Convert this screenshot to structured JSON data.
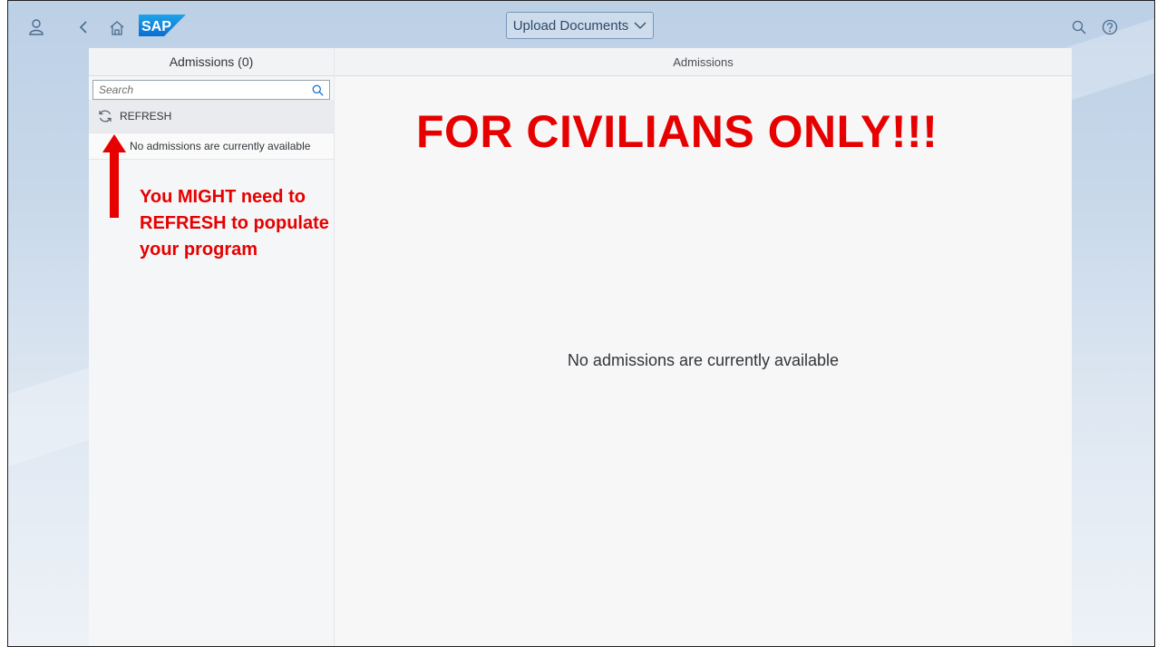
{
  "shell": {
    "app_title": "Upload Documents",
    "icons": [
      "user-icon",
      "back-icon",
      "home-icon",
      "sap-logo",
      "search-icon",
      "help-icon"
    ],
    "logo_text": "SAP"
  },
  "master": {
    "title": "Admissions (0)",
    "search_placeholder": "Search",
    "refresh_label": "REFRESH",
    "empty_text": "No admissions are currently available"
  },
  "detail": {
    "title": "Admissions",
    "empty_text": "No admissions are currently available"
  },
  "annotations": {
    "banner": "FOR CIVILIANS ONLY!!!",
    "refresh_hint": "You MIGHT need to REFRESH to populate your program",
    "color": "#e60000"
  }
}
